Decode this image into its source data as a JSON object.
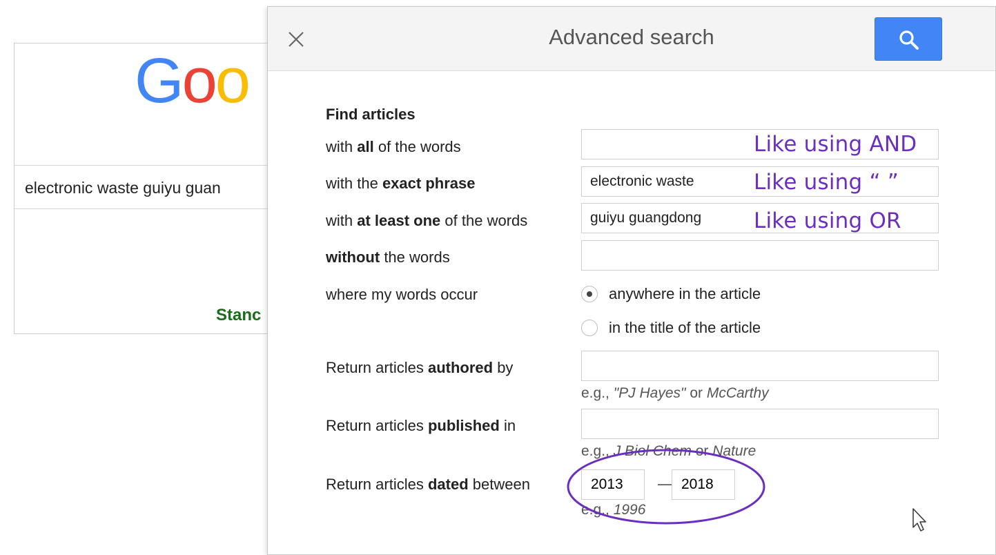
{
  "background": {
    "logo_letters": [
      "G",
      "o",
      "o"
    ],
    "search_value": "electronic waste guiyu guan",
    "partial_link": "Stanc"
  },
  "dialog": {
    "title": "Advanced search",
    "close_icon": "close-icon",
    "search_icon": "search-icon",
    "section_title": "Find articles",
    "rows": {
      "all_words": {
        "pre": "with ",
        "bold": "all",
        "post": " of the words",
        "value": ""
      },
      "exact_phrase": {
        "pre": "with the ",
        "bold": "exact phrase",
        "post": "",
        "value": "electronic waste"
      },
      "at_least_one": {
        "pre": "with ",
        "bold": "at least one",
        "post": " of the words",
        "value": "guiyu guangdong"
      },
      "without": {
        "pre": "",
        "bold": "without",
        "post": " the words",
        "value": ""
      }
    },
    "occur": {
      "label": "where my words occur",
      "options": [
        {
          "label": "anywhere in the article",
          "checked": true
        },
        {
          "label": "in the title of the article",
          "checked": false
        }
      ]
    },
    "authored": {
      "pre": "Return articles ",
      "bold": "authored",
      "post": " by",
      "value": "",
      "hint_prefix": "e.g., ",
      "hint_ex1": "\"PJ Hayes\"",
      "hint_mid": " or ",
      "hint_ex2": "McCarthy"
    },
    "published": {
      "pre": "Return articles ",
      "bold": "published",
      "post": " in",
      "value": "",
      "hint_prefix": "e.g., ",
      "hint_ex1": "J Biol Chem",
      "hint_mid": " or ",
      "hint_ex2": "Nature"
    },
    "dated": {
      "pre": "Return articles ",
      "bold": "dated",
      "post": " between",
      "from": "2013",
      "separator": "—",
      "to": "2018",
      "hint_prefix": "e.g., ",
      "hint_ex1": "1996"
    }
  },
  "annotations": {
    "color": "#6a2fbf",
    "and_note": "Like using AND",
    "quote_note": "Like using “ ”",
    "or_note": "Like using OR"
  },
  "colors": {
    "search_button": "#4285f4",
    "header_bg": "#f4f4f4",
    "logo_blue": "#4285f4",
    "logo_red": "#ea4335",
    "logo_yellow": "#fbbc05",
    "link_green": "#1a6e1a"
  }
}
